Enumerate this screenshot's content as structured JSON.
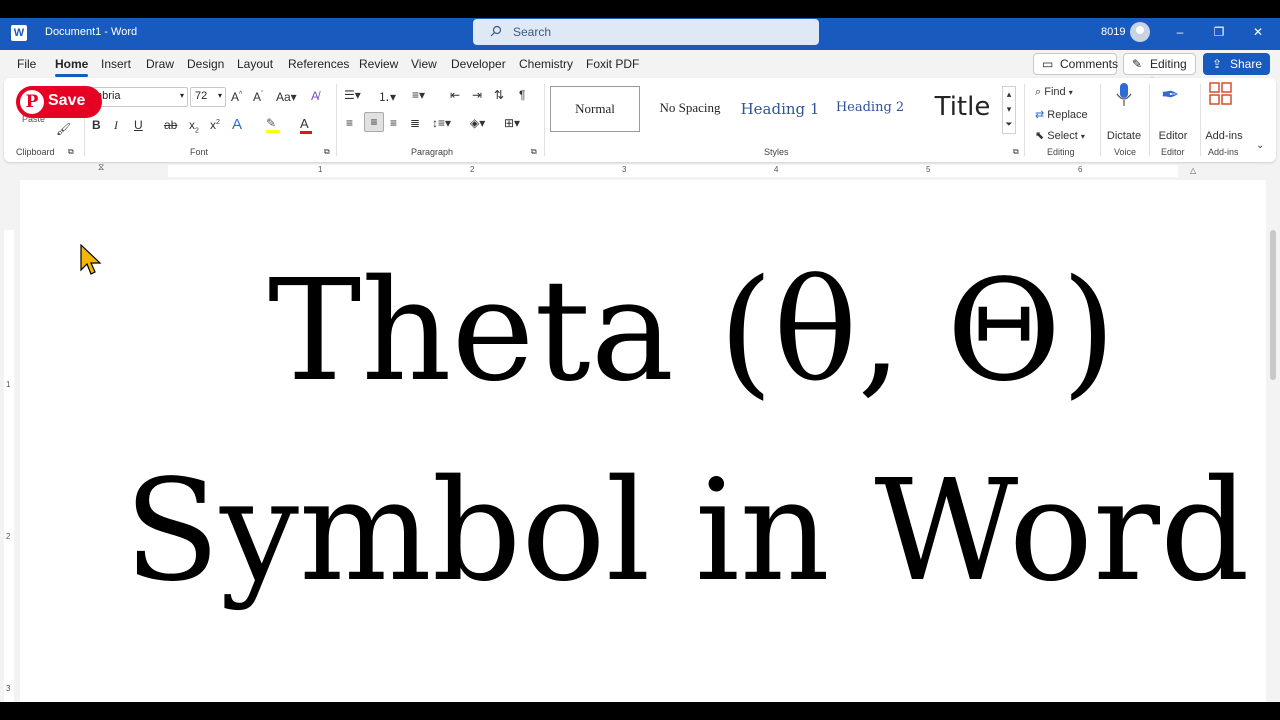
{
  "titlebar": {
    "doc_title": "Document1 - Word",
    "search_placeholder": "Search",
    "user_id": "8019",
    "minimize": "–",
    "restore": "❐",
    "close": "✕"
  },
  "tabs": [
    "File",
    "Home",
    "Insert",
    "Draw",
    "Design",
    "Layout",
    "References",
    "Review",
    "View",
    "Developer",
    "Chemistry",
    "Foxit PDF"
  ],
  "active_tab": "Home",
  "top_buttons": {
    "comments": "Comments",
    "editing": "Editing",
    "share": "Share"
  },
  "pinterest": {
    "label": "Save",
    "logo": "P"
  },
  "clipboard": {
    "paste": "Paste",
    "label": "Clipboard"
  },
  "font": {
    "name": "mbria",
    "size": "72",
    "label": "Font"
  },
  "paragraph": {
    "label": "Paragraph"
  },
  "styles": {
    "items": [
      "Normal",
      "No Spacing",
      "Heading 1",
      "Heading 2",
      "Title"
    ],
    "label": "Styles"
  },
  "editing_group": {
    "find": "Find",
    "replace": "Replace",
    "select": "Select",
    "label": "Editing"
  },
  "voice": {
    "dictate": "Dictate",
    "label": "Voice"
  },
  "editor": {
    "editor": "Editor",
    "label": "Editor"
  },
  "addins": {
    "addins": "Add-ins",
    "label": "Add-ins"
  },
  "ruler": {
    "numbers": [
      "1",
      "2",
      "3",
      "4",
      "5",
      "6"
    ]
  },
  "vruler": {
    "numbers": [
      "1",
      "2",
      "3"
    ]
  },
  "document": {
    "line1": "Theta (θ, Θ)",
    "line2": "Symbol in Word"
  },
  "colors": {
    "title_bar": "#185abd",
    "pinterest": "#e60023",
    "heading": "#2f5496"
  }
}
